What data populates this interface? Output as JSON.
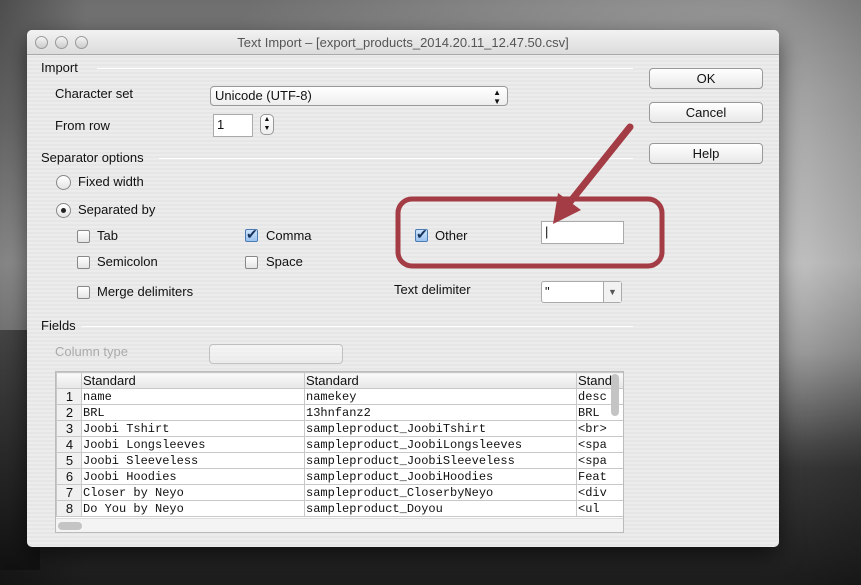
{
  "window": {
    "title": "Text Import – [export_products_2014.20.11_12.47.50.csv]"
  },
  "import": {
    "section": "Import",
    "charset_label": "Character set",
    "charset_value": "Unicode (UTF-8)",
    "from_row_label": "From row",
    "from_row_value": "1"
  },
  "separator": {
    "section": "Separator options",
    "fixed_width": "Fixed width",
    "separated_by": "Separated by",
    "mode": "separated_by",
    "tab": {
      "label": "Tab",
      "checked": false
    },
    "comma": {
      "label": "Comma",
      "checked": true
    },
    "semicolon": {
      "label": "Semicolon",
      "checked": false
    },
    "space": {
      "label": "Space",
      "checked": false
    },
    "merge": {
      "label": "Merge delimiters",
      "checked": false
    },
    "other": {
      "label": "Other",
      "checked": true,
      "value": "|"
    },
    "text_delimiter_label": "Text delimiter",
    "text_delimiter_value": "\""
  },
  "buttons": {
    "ok": "OK",
    "cancel": "Cancel",
    "help": "Help"
  },
  "fields": {
    "section": "Fields",
    "column_type_label": "Column type",
    "headers": [
      "Standard",
      "Standard",
      "Stand"
    ],
    "rows": [
      [
        "1",
        "name",
        "namekey",
        "desc"
      ],
      [
        "2",
        "BRL",
        "13hnfanz2",
        "BRL"
      ],
      [
        "3",
        "Joobi Tshirt",
        "sampleproduct_JoobiTshirt",
        "<br>"
      ],
      [
        "4",
        "Joobi Longsleeves",
        "sampleproduct_JoobiLongsleeves",
        "<spa"
      ],
      [
        "5",
        "Joobi Sleeveless",
        "sampleproduct_JoobiSleeveless",
        "<spa"
      ],
      [
        "6",
        "Joobi Hoodies",
        "sampleproduct_JoobiHoodies",
        "Feat"
      ],
      [
        "7",
        "Closer by Neyo",
        "sampleproduct_CloserbyNeyo",
        "<div"
      ],
      [
        "8",
        "Do You by Neyo",
        "sampleproduct_Doyou",
        "<ul"
      ]
    ]
  },
  "annotation": {
    "color": "#a33c44"
  }
}
